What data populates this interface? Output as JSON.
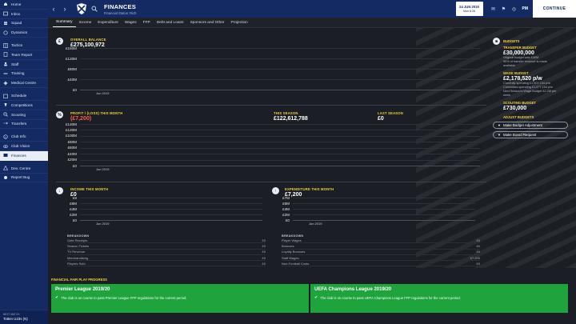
{
  "sidebar": {
    "items": [
      {
        "label": "Home",
        "icon": "home-icon"
      },
      {
        "label": "Inbox",
        "icon": "inbox-icon"
      },
      {
        "label": "Squad",
        "icon": "squad-icon"
      },
      {
        "label": "Dynamics",
        "icon": "dynamics-icon"
      },
      {
        "label": "Tactics",
        "icon": "tactics-icon"
      },
      {
        "label": "Team Report",
        "icon": "team-report-icon"
      },
      {
        "label": "Staff",
        "icon": "staff-icon"
      },
      {
        "label": "Training",
        "icon": "training-icon"
      },
      {
        "label": "Medical Centre",
        "icon": "medical-icon"
      },
      {
        "label": "Schedule",
        "icon": "schedule-icon"
      },
      {
        "label": "Competitions",
        "icon": "trophy-icon"
      },
      {
        "label": "Scouting",
        "icon": "scouting-icon"
      },
      {
        "label": "Transfers",
        "icon": "transfers-icon"
      },
      {
        "label": "Club Info",
        "icon": "club-info-icon"
      },
      {
        "label": "Club Vision",
        "icon": "club-vision-icon"
      },
      {
        "label": "Finances",
        "icon": "finances-icon"
      },
      {
        "label": "Dev. Centre",
        "icon": "dev-centre-icon"
      },
      {
        "label": "Report Bug",
        "icon": "report-bug-icon"
      }
    ],
    "active_index": 15,
    "footer_line1": "NEXT MATCH",
    "footer_line2": "Totten U23s (N)"
  },
  "header": {
    "title": "FINANCES",
    "subtitle": "Financial Status: Rich",
    "date_line1": "24 JUN 2019",
    "date_line2": "Mon 6:26",
    "time_badge": "PM",
    "continue_label": "CONTINUE"
  },
  "tabs": [
    {
      "label": "Summary"
    },
    {
      "label": "Income"
    },
    {
      "label": "Expenditure"
    },
    {
      "label": "Wages"
    },
    {
      "label": "FFP"
    },
    {
      "label": "Debt and Loans"
    },
    {
      "label": "Sponsors and Other"
    },
    {
      "label": "Projection"
    }
  ],
  "overall_balance": {
    "title": "OVERALL BALANCE",
    "value": "£275,100,972"
  },
  "profit_loss": {
    "title": "PROFIT / (LOSS) THIS MONTH",
    "value": "(£7,200)"
  },
  "this_season": {
    "title": "THIS SEASON",
    "value": "£122,612,788"
  },
  "last_season": {
    "title": "LAST SEASON",
    "value": "£0"
  },
  "income_month": {
    "title": "INCOME THIS MONTH",
    "value": "£0"
  },
  "expenditure_month": {
    "title": "EXPENDITURE THIS MONTH",
    "value": "£7,200"
  },
  "income_breakdown": {
    "title": "BREAKDOWN",
    "rows": [
      {
        "label": "Gate Receipts",
        "value": "£0"
      },
      {
        "label": "Season Tickets",
        "value": "£0"
      },
      {
        "label": "TV Revenue",
        "value": "£0"
      },
      {
        "label": "Merchandising",
        "value": "£0"
      },
      {
        "label": "Players Sold",
        "value": "£0"
      }
    ]
  },
  "expenditure_breakdown": {
    "title": "BREAKDOWN",
    "rows": [
      {
        "label": "Player Wages",
        "value": "£0"
      },
      {
        "label": "Bonuses",
        "value": "£0"
      },
      {
        "label": "Loyalty Bonuses",
        "value": "£0"
      },
      {
        "label": "Staff Wages",
        "value": "£7,200"
      },
      {
        "label": "Non-Football Costs",
        "value": "£0"
      }
    ]
  },
  "right_panel": {
    "budgets_title": "BUDGETS",
    "transfer_title": "TRANSFER BUDGET",
    "transfer_value": "£30,000,000",
    "transfer_line1": "Original budget was £30M",
    "transfer_line2": "90% of transfer revenue is made",
    "transfer_line3": "available",
    "wage_title": "WAGE BUDGET",
    "wage_value": "£2,178,520 p/w",
    "wage_line1": "Currently spending £1,907,154 p/w",
    "wage_line2": "Committed spending £1,977,154 p/w",
    "wage_line3": "Next Season's Wage Budget £2.2M per",
    "wage_line4": "week",
    "scouting_title": "SCOUTING BUDGET",
    "scouting_value": "£730,000",
    "adjust_title": "ADJUST BUDGETS",
    "btn1": "Make Budget Adjustment",
    "btn2": "Make Board Request"
  },
  "ffp": {
    "title": "FINANCIAL FAIR PLAY PROGRESS",
    "cards": [
      {
        "title": "Premier League 2019/20",
        "text": "The club is on course to pass Premier League FFP regulations for the current period."
      },
      {
        "title": "UEFA Champions League 2019/20",
        "text": "The club is on course to pass UEFA Champions League FFP regulations for the current period."
      }
    ]
  },
  "chart_data": [
    {
      "type": "line",
      "title": "OVERALL BALANCE",
      "x": [
        "Jun 2019"
      ],
      "yticks": [
        "£160M",
        "£120M",
        "£80M",
        "£40M",
        "£0"
      ],
      "ylim": [
        0,
        160000000
      ],
      "series": []
    },
    {
      "type": "line",
      "title": "PROFIT / (LOSS) THIS MONTH",
      "x": [
        "Jun 2019"
      ],
      "yticks": [
        "£140M",
        "£120M",
        "£100M",
        "£80M",
        "£60M",
        "£40M",
        "£20M",
        "£0"
      ],
      "ylim": [
        0,
        140000000
      ],
      "series": []
    },
    {
      "type": "line",
      "title": "INCOME THIS MONTH",
      "x": [
        "Jun 2019"
      ],
      "yticks": [
        "£8",
        "£6M",
        "£4M",
        "£2M",
        "£0"
      ],
      "series": []
    },
    {
      "type": "line",
      "title": "EXPENDITURE THIS MONTH",
      "x": [
        "Jun 2019"
      ],
      "yticks": [
        "£7M",
        "£6M",
        "£4M",
        "£2M",
        "£0"
      ],
      "series": []
    }
  ],
  "colors": {
    "sidebar": "#132a63",
    "accent": "#f2d33a",
    "negative": "#ff5a4b",
    "ffp_green": "#1fa33c"
  }
}
